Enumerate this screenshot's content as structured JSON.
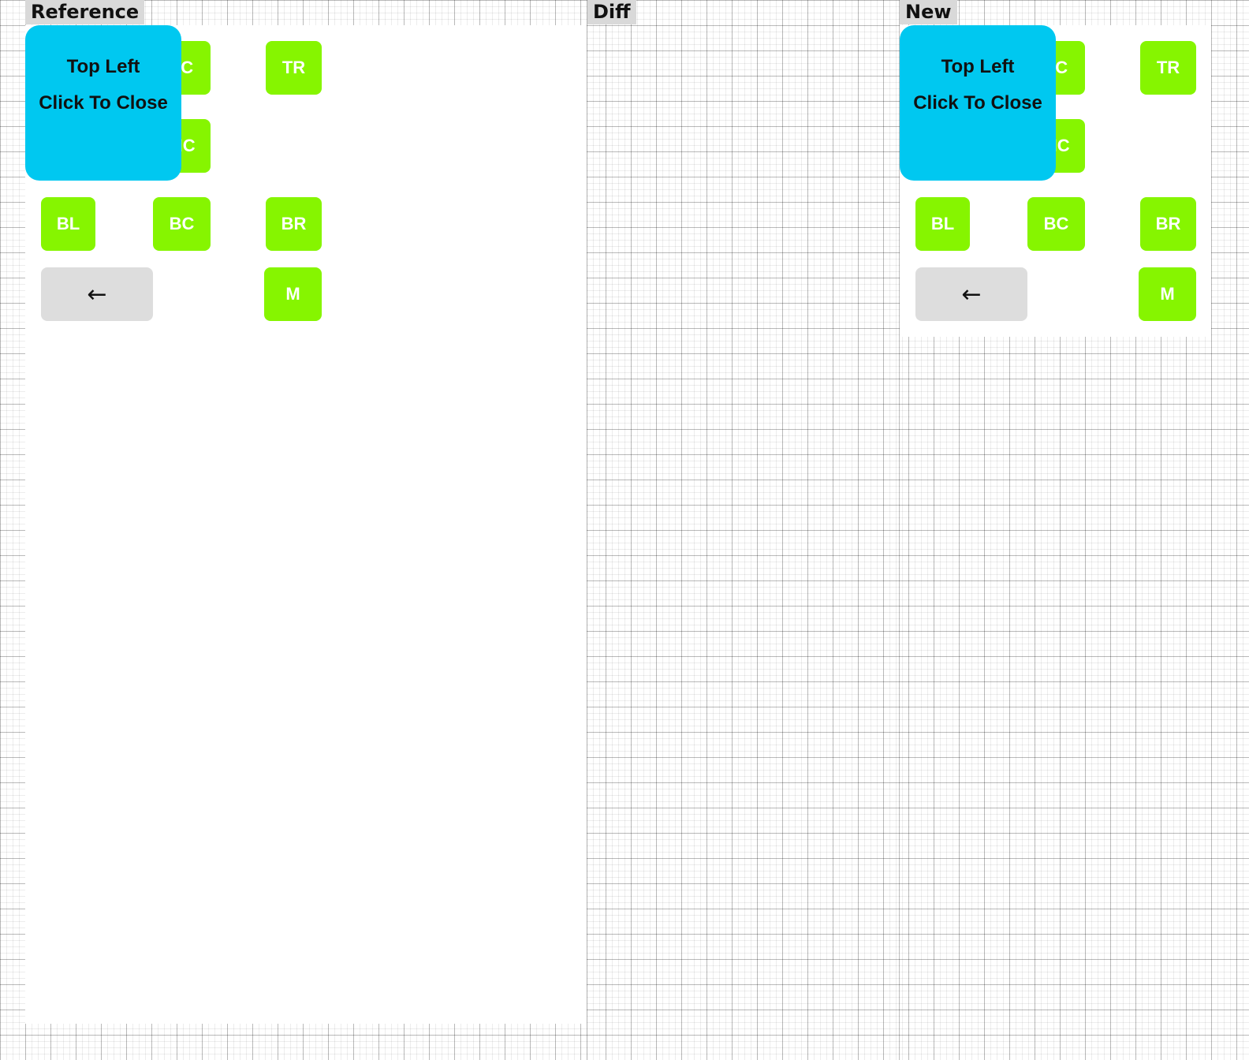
{
  "labels": {
    "reference": "Reference",
    "diff": "Diff",
    "new": "New"
  },
  "reference": {
    "popup": {
      "title": "Top Left",
      "action": "Click To Close"
    },
    "buttons": {
      "top_left": "",
      "top_center": "TC",
      "top_right": "TR",
      "middle_left": "",
      "middle_center": "MC",
      "bottom_left": "BL",
      "bottom_center": "BC",
      "bottom_right": "BR",
      "back": "←",
      "menu": "M"
    }
  },
  "new": {
    "popup": {
      "title": "Top Left",
      "action": "Click To Close"
    },
    "buttons": {
      "top_left": "",
      "top_center": "TC",
      "top_right": "TR",
      "middle_left": "",
      "middle_center": "MC",
      "bottom_left": "BL",
      "bottom_center": "BC",
      "bottom_right": "BR",
      "back": "←",
      "menu": "M"
    }
  },
  "colors": {
    "button_green": "#86f500",
    "popup_blue": "#00c8f0",
    "back_button_gray": "#dddddd",
    "label_background": "#d9d9d9"
  },
  "icons": {
    "back": "left-arrow-icon"
  }
}
